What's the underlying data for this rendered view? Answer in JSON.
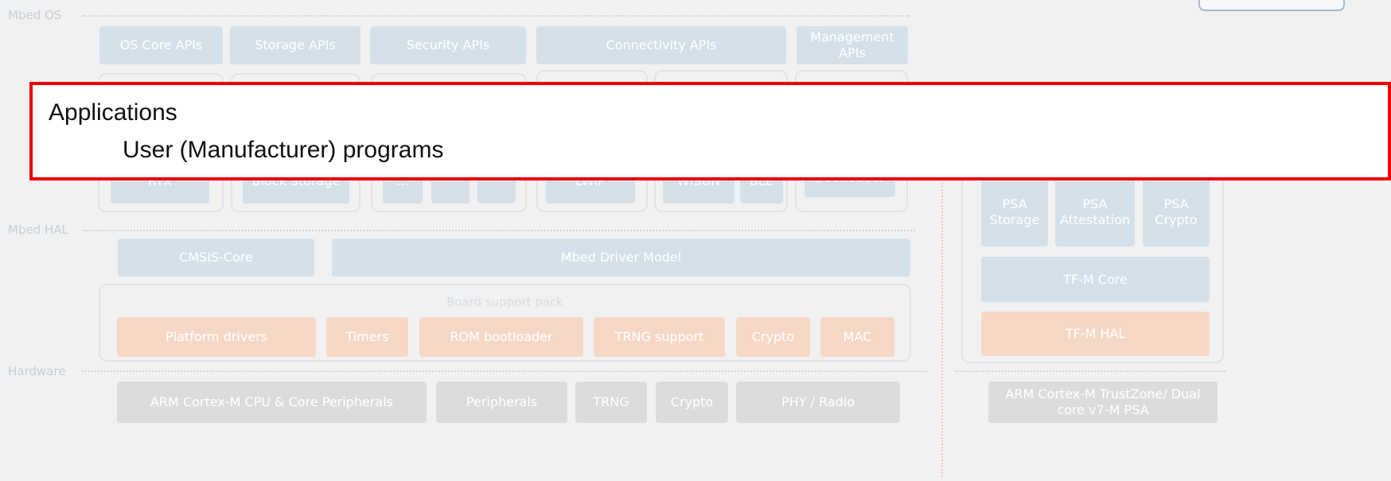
{
  "layers": {
    "mbed_os": "Mbed OS",
    "mbed_hal": "Mbed HAL",
    "hardware": "Hardware"
  },
  "apis": {
    "os_core": "OS Core APIs",
    "storage": "Storage APIs",
    "security": "Security APIs",
    "connectivity": "Connectivity APIs",
    "management": "Management APIs"
  },
  "os_components": {
    "rtx": "RTX",
    "block_storage": "Block Storage",
    "small_1": "...",
    "lwip": "LWIP",
    "wisun": "WISUN",
    "ble": "BLE",
    "bootloader": "Bootloader"
  },
  "hal": {
    "cmsis": "CMSIS-Core",
    "driver_model": "Mbed Driver Model",
    "bsp_title": "Board support pack"
  },
  "bsp": {
    "platform_drivers": "Platform drivers",
    "timers": "Timers",
    "rom_bootloader": "ROM bootloader",
    "trng_support": "TRNG support",
    "crypto": "Crypto",
    "mac": "MAC"
  },
  "hardware_items": {
    "cpu": "ARM Cortex-M CPU & Core Peripherals",
    "peripherals": "Peripherals",
    "trng": "TRNG",
    "crypto": "Crypto",
    "phy": "PHY / Radio"
  },
  "psa": {
    "storage": "PSA Storage",
    "attestation": "PSA Attestation",
    "crypto": "PSA Crypto",
    "tfm_core": "TF-M Core",
    "tfm_hal": "TF-M HAL",
    "trustzone": "ARM Cortex-M TrustZone/ Dual core v7-M PSA"
  },
  "overlay": {
    "title": "Applications",
    "subtitle": "User (Manufacturer) programs"
  },
  "colors": {
    "highlight_border": "#ee0000",
    "api_blue": "#d4e1ea",
    "bsp_orange": "#f6d8c7",
    "hardware_gray": "#dcdcdc"
  }
}
